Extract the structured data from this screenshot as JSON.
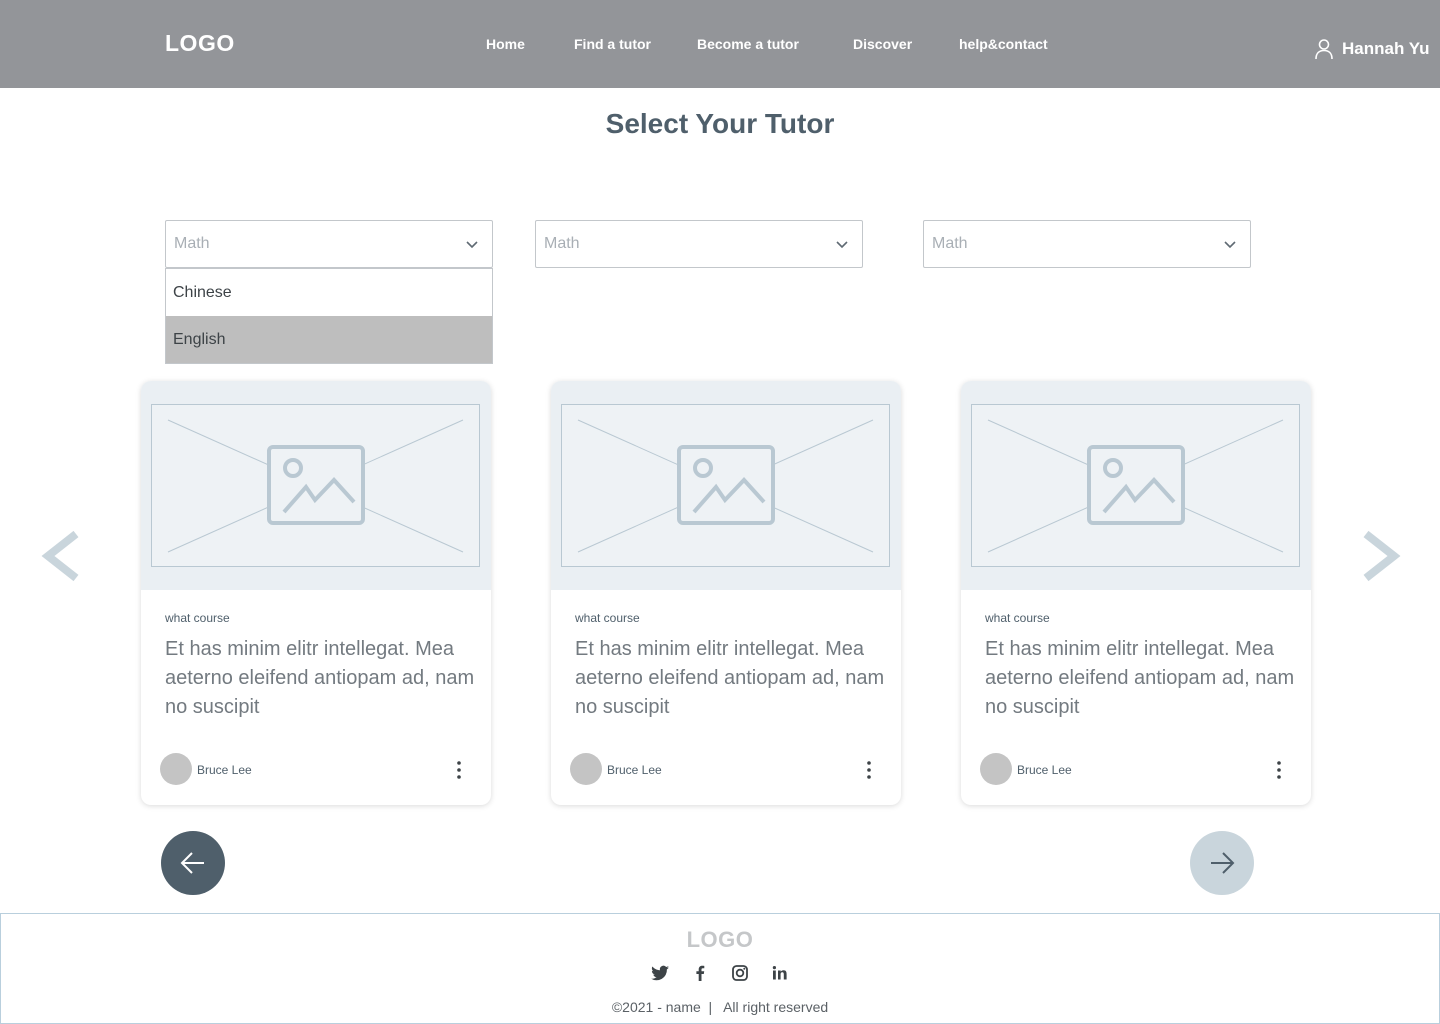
{
  "header": {
    "logo": "LOGO",
    "nav": [
      "Home",
      "Find a tutor",
      "Become a tutor",
      "Discover",
      "help&contact"
    ],
    "user_name": "Hannah Yu"
  },
  "page_title": "Select Your Tutor",
  "filters": [
    {
      "value": "Math",
      "options": [
        "Chinese",
        "English"
      ],
      "highlighted": "English"
    },
    {
      "value": "Math"
    },
    {
      "value": "Math"
    }
  ],
  "cards": [
    {
      "course": "what course",
      "text": "Et has minim elitr intellegat. Mea aeterno eleifend antiopam ad, nam no suscipit",
      "author": "Bruce Lee"
    },
    {
      "course": "what course",
      "text": "Et has minim elitr intellegat. Mea aeterno eleifend antiopam ad, nam no suscipit",
      "author": "Bruce Lee"
    },
    {
      "course": "what course",
      "text": "Et has minim elitr intellegat. Mea aeterno eleifend antiopam ad, nam no suscipit",
      "author": "Bruce Lee"
    }
  ],
  "footer": {
    "logo": "LOGO",
    "social_icons": [
      "twitter-icon",
      "facebook-icon",
      "instagram-icon",
      "linkedin-icon"
    ],
    "copyright": "©2021 - name  |   All right reserved"
  },
  "colors": {
    "header_bg": "#939599",
    "title": "#4f5f6b",
    "prev_button": "#4f5f6b",
    "next_button": "#c9d5dc",
    "arrow": "#c9d5dc"
  }
}
